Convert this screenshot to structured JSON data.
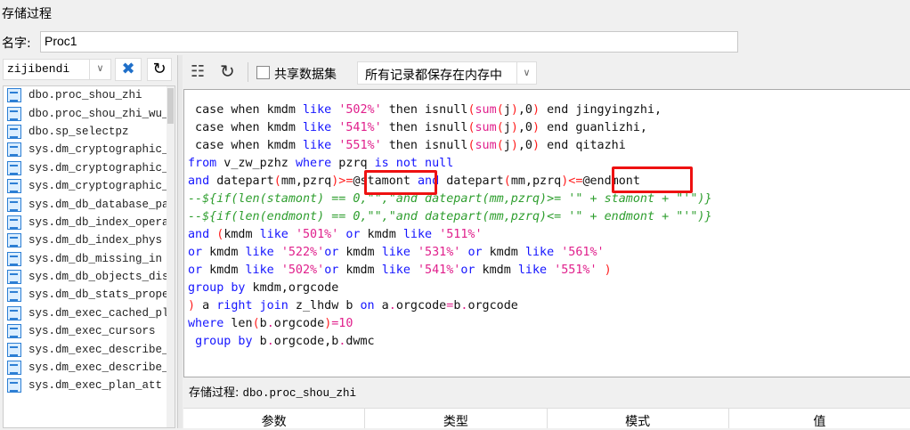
{
  "window": {
    "title": "存储过程"
  },
  "name_field": {
    "label": "名字:",
    "value": "Proc1"
  },
  "left": {
    "database": "zijibendi",
    "items": [
      "dbo.proc_shou_zhi",
      "dbo.proc_shou_zhi_wu_",
      "dbo.sp_selectpz",
      "sys.dm_cryptographic_",
      "sys.dm_cryptographic_",
      "sys.dm_cryptographic_",
      "sys.dm_db_database_pa",
      "sys.dm_db_index_opera",
      "sys.dm_db_index_phys",
      "sys.dm_db_missing_in",
      "sys.dm_db_objects_dis",
      "sys.dm_db_stats_prope",
      "sys.dm_exec_cached_pl",
      "sys.dm_exec_cursors",
      "sys.dm_exec_describe_",
      "sys.dm_exec_describe_",
      "sys.dm_exec_plan_att"
    ]
  },
  "toolbar": {
    "shared_dataset_label": "共享数据集",
    "shared_dataset_checked": false,
    "mode": "所有记录都保存在内存中"
  },
  "code_lines": [
    [
      [
        "t",
        " case when kmdm "
      ],
      [
        "k",
        "like"
      ],
      [
        "t",
        " "
      ],
      [
        "s",
        "'502%'"
      ],
      [
        "t",
        " then isnull"
      ],
      [
        "p",
        "("
      ],
      [
        "f",
        "sum"
      ],
      [
        "p",
        "("
      ],
      [
        "t",
        "j"
      ],
      [
        "p",
        ")"
      ],
      [
        "t",
        ",0"
      ],
      [
        "p",
        ")"
      ],
      [
        "t",
        " end jingyingzhi,"
      ]
    ],
    [
      [
        "t",
        " case when kmdm "
      ],
      [
        "k",
        "like"
      ],
      [
        "t",
        " "
      ],
      [
        "s",
        "'541%'"
      ],
      [
        "t",
        " then isnull"
      ],
      [
        "p",
        "("
      ],
      [
        "f",
        "sum"
      ],
      [
        "p",
        "("
      ],
      [
        "t",
        "j"
      ],
      [
        "p",
        ")"
      ],
      [
        "t",
        ",0"
      ],
      [
        "p",
        ")"
      ],
      [
        "t",
        " end guanlizhi,"
      ]
    ],
    [
      [
        "t",
        " case when kmdm "
      ],
      [
        "k",
        "like"
      ],
      [
        "t",
        " "
      ],
      [
        "s",
        "'551%'"
      ],
      [
        "t",
        " then isnull"
      ],
      [
        "p",
        "("
      ],
      [
        "f",
        "sum"
      ],
      [
        "p",
        "("
      ],
      [
        "t",
        "j"
      ],
      [
        "p",
        ")"
      ],
      [
        "t",
        ",0"
      ],
      [
        "p",
        ")"
      ],
      [
        "t",
        " end qitazhi"
      ]
    ],
    [
      [
        "k",
        "from"
      ],
      [
        "t",
        " v_zw_pzhz "
      ],
      [
        "k",
        "where"
      ],
      [
        "t",
        " pzrq "
      ],
      [
        "k",
        "is not null"
      ]
    ],
    [
      [
        "k",
        "and"
      ],
      [
        "t",
        " datepart"
      ],
      [
        "p",
        "("
      ],
      [
        "t",
        "mm,pzrq"
      ],
      [
        "p",
        ")>="
      ],
      [
        "t",
        "@stamont "
      ],
      [
        "k",
        "and"
      ],
      [
        "t",
        " datepart"
      ],
      [
        "p",
        "("
      ],
      [
        "t",
        "mm,pzrq"
      ],
      [
        "p",
        ")<="
      ],
      [
        "t",
        "@endmont"
      ]
    ],
    [
      [
        "c",
        "--${if(len(stamont) == 0,\"\",\"and datepart(mm,pzrq)>= '\" + stamont + \"'\")}"
      ]
    ],
    [
      [
        "c",
        "--${if(len(endmont) == 0,\"\",\"and datepart(mm,pzrq)<= '\" + endmont + \"'\")}"
      ]
    ],
    [
      [
        "k",
        "and"
      ],
      [
        "t",
        " "
      ],
      [
        "p",
        "("
      ],
      [
        "t",
        "kmdm "
      ],
      [
        "k",
        "like"
      ],
      [
        "t",
        " "
      ],
      [
        "s",
        "'501%'"
      ],
      [
        "t",
        " "
      ],
      [
        "k",
        "or"
      ],
      [
        "t",
        " kmdm "
      ],
      [
        "k",
        "like"
      ],
      [
        "t",
        " "
      ],
      [
        "s",
        "'511%'"
      ]
    ],
    [
      [
        "k",
        "or"
      ],
      [
        "t",
        " kmdm "
      ],
      [
        "k",
        "like"
      ],
      [
        "t",
        " "
      ],
      [
        "s",
        "'522%'"
      ],
      [
        "k",
        "or"
      ],
      [
        "t",
        " kmdm "
      ],
      [
        "k",
        "like"
      ],
      [
        "t",
        " "
      ],
      [
        "s",
        "'531%'"
      ],
      [
        "t",
        " "
      ],
      [
        "k",
        "or"
      ],
      [
        "t",
        " kmdm "
      ],
      [
        "k",
        "like"
      ],
      [
        "t",
        " "
      ],
      [
        "s",
        "'561%'"
      ]
    ],
    [
      [
        "k",
        "or"
      ],
      [
        "t",
        " kmdm "
      ],
      [
        "k",
        "like"
      ],
      [
        "t",
        " "
      ],
      [
        "s",
        "'502%'"
      ],
      [
        "k",
        "or"
      ],
      [
        "t",
        " kmdm "
      ],
      [
        "k",
        "like"
      ],
      [
        "t",
        " "
      ],
      [
        "s",
        "'541%'"
      ],
      [
        "k",
        "or"
      ],
      [
        "t",
        " kmdm "
      ],
      [
        "k",
        "like"
      ],
      [
        "t",
        " "
      ],
      [
        "s",
        "'551%'"
      ],
      [
        "t",
        " "
      ],
      [
        "p",
        ")"
      ]
    ],
    [
      [
        "k",
        "group by"
      ],
      [
        "t",
        " kmdm,orgcode"
      ]
    ],
    [
      [
        "p",
        ")"
      ],
      [
        "t",
        " a "
      ],
      [
        "k",
        "right join"
      ],
      [
        "t",
        " z_lhdw b "
      ],
      [
        "k",
        "on"
      ],
      [
        "t",
        " a"
      ],
      [
        "f",
        "."
      ],
      [
        "t",
        "orgcode"
      ],
      [
        "f",
        "="
      ],
      [
        "t",
        "b"
      ],
      [
        "f",
        "."
      ],
      [
        "t",
        "orgcode"
      ]
    ],
    [
      [
        "k",
        "where"
      ],
      [
        "t",
        " len"
      ],
      [
        "p",
        "("
      ],
      [
        "t",
        "b"
      ],
      [
        "f",
        "."
      ],
      [
        "t",
        "orgcode"
      ],
      [
        "p",
        ")"
      ],
      [
        "f",
        "=10"
      ]
    ],
    [
      [
        "t",
        " "
      ],
      [
        "k",
        "group by"
      ],
      [
        "t",
        " b"
      ],
      [
        "f",
        "."
      ],
      [
        "t",
        "orgcode,b"
      ],
      [
        "f",
        "."
      ],
      [
        "t",
        "dwmc"
      ]
    ]
  ],
  "status": {
    "label": "存储过程:",
    "value": "dbo.proc_shou_zhi"
  },
  "params_table": {
    "columns": [
      "参数",
      "类型",
      "模式",
      "值"
    ]
  }
}
